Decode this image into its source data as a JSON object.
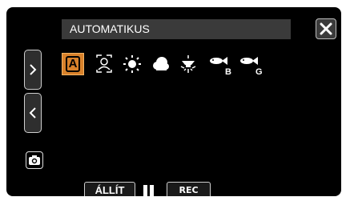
{
  "header": {
    "title": "AUTOMATIKUS"
  },
  "icons": {
    "close": "close-icon",
    "next": "chevron-right-icon",
    "prev": "chevron-left-icon",
    "camera": "camera-icon",
    "pause": "pause-icon"
  },
  "scenes": [
    {
      "name": "auto",
      "label": "A",
      "selected": true
    },
    {
      "name": "portrait",
      "selected": false
    },
    {
      "name": "sunny",
      "selected": false
    },
    {
      "name": "cloudy",
      "selected": false
    },
    {
      "name": "night-light",
      "selected": false
    },
    {
      "name": "underwater-blue",
      "label": "B",
      "selected": false
    },
    {
      "name": "underwater-green",
      "label": "G",
      "selected": false
    }
  ],
  "controls": {
    "set_label": "ÁLLÍT",
    "rec_label": "REC"
  },
  "colors": {
    "screen_bg": "#000000",
    "title_bg": "#3a3a3a",
    "selected_accent": "#d9822b"
  }
}
